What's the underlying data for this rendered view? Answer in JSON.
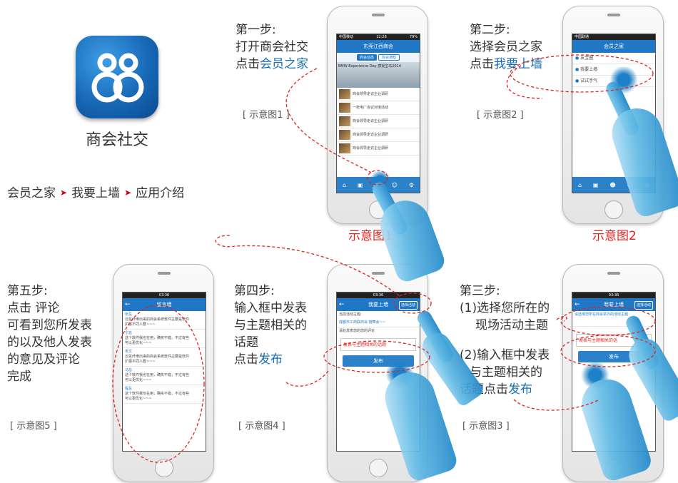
{
  "app": {
    "name": "商会社交",
    "icon": "club-people-icon"
  },
  "breadcrumb": [
    "会员之家",
    "我要上墙",
    "应用介绍"
  ],
  "steps": {
    "s1": {
      "l1": "第一步:",
      "l2": "打开商会社交",
      "l3a": "点击",
      "l3b": "会员之家",
      "cap": "[ 示意图1 ]",
      "cap_red": "示意图1"
    },
    "s2": {
      "l1": "第二步:",
      "l2": "选择会员之家",
      "l3a": "点击",
      "l3b": "我要上墙",
      "cap": "[ 示意图2 ]",
      "cap_red": "示意图2"
    },
    "s3": {
      "l1": "第三步:",
      "l2": "(1)选择您所在的",
      "l3": "现场活动主题",
      "l4": "(2)输入框中发表",
      "l5": "与主题相关的",
      "l6a": "话题点击",
      "l6b": "发布",
      "cap": "[ 示意图3 ]"
    },
    "s4": {
      "l1": "第四步:",
      "l2": "输入框中发表",
      "l3": "与主题相关的",
      "l4": "话题",
      "l5a": "点击",
      "l5b": "发布",
      "cap": "[ 示意图4 ]"
    },
    "s5": {
      "l1": "第五步:",
      "l2": "点击 评论",
      "l3": "可看到您所发表",
      "l4": "的以及他人发表",
      "l5": "的意见及评论",
      "l6": "完成",
      "cap": "[ 示意图5 ]"
    }
  },
  "phone1": {
    "status_left": "中国移动",
    "time": "12:28",
    "battery": "79%",
    "title": "东莞江西商会",
    "tab_a": "商会动态",
    "tab_b": "协会通知",
    "banner": "BMW Experience Day 感受宝马2014",
    "rows": [
      "商会领导走访企业调研",
      "一张电厂会议对接活动",
      "商会领导走访企业调研",
      "商会领导走访企业调研",
      "商会领导走访企业调研"
    ]
  },
  "phone2": {
    "status_left": "中国联通",
    "title": "会员之家",
    "items": [
      "友宝圈",
      "我要上墙",
      "试试手气"
    ]
  },
  "phone3": {
    "time": "03:36",
    "title": "我要上墙",
    "btn": "选择活动",
    "hint": "请选择您所在商会举办的活动主题",
    "input": "发表与主题相关的话",
    "submit": "发布"
  },
  "phone4": {
    "time": "03:36",
    "title": "我要上墙",
    "btn": "选择活动",
    "activity_label": "当前活动主题:",
    "activity": "成都市工商联商会 鼓舞会~~",
    "hint": "请处发表您的您的评论",
    "input": "发表与主题相关的话题",
    "submit": "发布"
  },
  "phone5": {
    "time": "03:36",
    "title": "留言墙",
    "msgs": [
      {
        "user": "张总",
        "text": "云氛纤维出来的商会系统软件主要是软件",
        "sub": "扩展不同人群~~~"
      },
      {
        "user": "宁总",
        "text": "这个软件我也在用，确实不错，不过有些",
        "sub": "可以更优化~~~"
      },
      {
        "user": "朱文",
        "text": "云氛纤维出来的商会系统软件主要是软件",
        "sub": "扩展不同人群~~~"
      },
      {
        "user": "马总",
        "text": "这个软件我也在用，确实不错，不过有些",
        "sub": "可以更优化~~~"
      },
      {
        "user": "程总",
        "text": "这个软件我也在用，确实不错，不过有些",
        "sub": "可以更优化~~~"
      }
    ]
  }
}
